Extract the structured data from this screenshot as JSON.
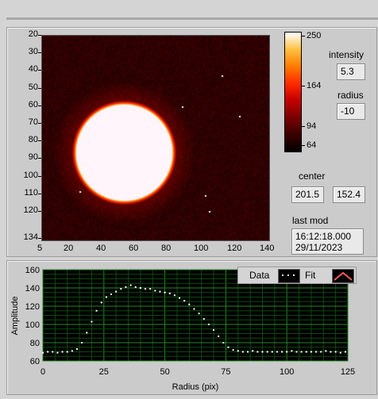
{
  "image_panel": {
    "y_ticks": [
      "20",
      "30",
      "40",
      "50",
      "60",
      "70",
      "80",
      "90",
      "100",
      "110",
      "120",
      "134"
    ],
    "x_ticks": [
      "5",
      "20",
      "40",
      "60",
      "80",
      "100",
      "120",
      "140"
    ]
  },
  "colorbar": {
    "labels": [
      "250",
      "164",
      "94",
      "64"
    ],
    "gradient": [
      "#000000",
      "#3a0000",
      "#7a0000",
      "#c20000",
      "#ff2a00",
      "#ff7a00",
      "#ffc040",
      "#ffffff"
    ]
  },
  "controls": {
    "intensity_label": "intensity",
    "intensity_value": "5.3",
    "radius_label": "radius",
    "radius_value": "-10",
    "center_label": "center",
    "center_x": "201.5",
    "center_y": "152.4",
    "last_mod_label": "last mod",
    "last_mod_time": "16:12:18.000",
    "last_mod_date": "29/11/2023"
  },
  "chart_data": {
    "type": "scatter",
    "xlabel": "Radius (pix)",
    "ylabel": "Amplitude",
    "xlim": [
      0,
      125
    ],
    "ylim": [
      60,
      160
    ],
    "x_ticks": [
      "0",
      "25",
      "50",
      "75",
      "100",
      "125"
    ],
    "y_ticks": [
      "160",
      "140",
      "120",
      "100",
      "80",
      "60"
    ],
    "legend": {
      "data_label": "Data",
      "fit_label": "Fit",
      "placement": "top-right"
    },
    "series": [
      {
        "name": "Data",
        "x": [
          0,
          2,
          4,
          6,
          8,
          10,
          12,
          14,
          16,
          18,
          20,
          22,
          24,
          26,
          28,
          30,
          32,
          34,
          36,
          38,
          40,
          42,
          44,
          46,
          48,
          50,
          52,
          54,
          56,
          58,
          60,
          62,
          64,
          66,
          68,
          70,
          72,
          74,
          76,
          78,
          80,
          82,
          84,
          86,
          88,
          90,
          92,
          94,
          96,
          98,
          100,
          102,
          104,
          106,
          108,
          110,
          112,
          114,
          116,
          118,
          120,
          122,
          124
        ],
        "y": [
          69,
          70,
          70,
          69,
          70,
          70,
          71,
          73,
          80,
          91,
          103,
          115,
          124,
          130,
          133,
          136,
          139,
          141,
          143,
          141,
          140,
          139,
          139,
          137,
          136,
          135,
          134,
          132,
          129,
          126,
          122,
          117,
          112,
          106,
          100,
          94,
          87,
          80,
          75,
          72,
          71,
          70,
          70,
          71,
          70,
          70,
          70,
          70,
          70,
          70,
          70,
          71,
          70,
          70,
          70,
          70,
          70,
          70,
          71,
          70,
          70,
          69,
          70
        ]
      }
    ]
  }
}
